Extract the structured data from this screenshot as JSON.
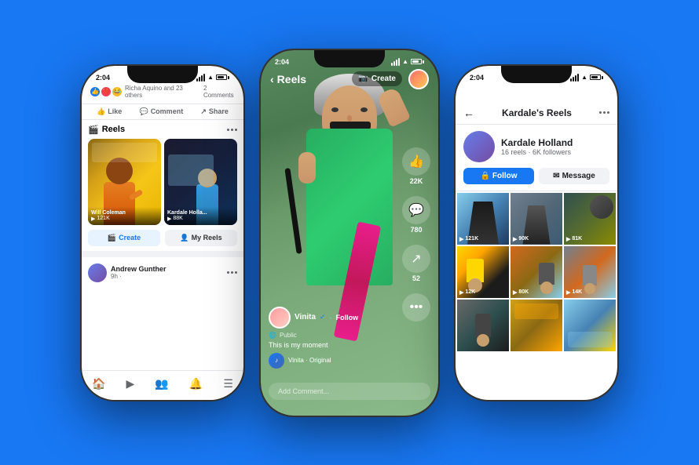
{
  "background_color": "#1877F2",
  "phones": {
    "left": {
      "status_time": "2:04",
      "reaction_text": "Richa Aquino and 23 others",
      "comments_count": "2 Comments",
      "actions": [
        "Like",
        "Comment",
        "Share"
      ],
      "reels_section_title": "Reels",
      "reels": [
        {
          "name": "Will Coleman",
          "views": "121K",
          "bg_class": "reel-bg-1"
        },
        {
          "name": "Kardale Holla...",
          "views": "88K",
          "bg_class": "reel-bg-2"
        }
      ],
      "btn_create": "Create",
      "btn_my_reels": "My Reels",
      "post_user": "Andrew Gunther",
      "post_time": "9h ·",
      "nav_items": [
        "home",
        "reels",
        "groups",
        "notifications",
        "menu"
      ]
    },
    "center": {
      "status_time": "2:04",
      "header_title": "Reels",
      "header_create": "Create",
      "username": "Vinita",
      "verified": true,
      "follow_text": "Follow",
      "privacy": "Public",
      "caption": "This is my moment",
      "music": "Vinita · Original",
      "likes_count": "22K",
      "comments_count": "780",
      "shares_count": "52",
      "comment_placeholder": "Add Comment..."
    },
    "right": {
      "status_time": "2:04",
      "page_title": "Kardale's Reels",
      "profile_name": "Kardale Holland",
      "profile_stats": "16 reels · 6K followers",
      "btn_follow": "Follow",
      "btn_message": "Message",
      "grid_items": [
        {
          "views": "121K",
          "bg": "gt1"
        },
        {
          "views": "90K",
          "bg": "gt2"
        },
        {
          "views": "81K",
          "bg": "gt3"
        },
        {
          "views": "12K",
          "bg": "gt4"
        },
        {
          "views": "80K",
          "bg": "gt5"
        },
        {
          "views": "14K",
          "bg": "gt6"
        },
        {
          "views": "",
          "bg": "gt7"
        },
        {
          "views": "",
          "bg": "gt8"
        },
        {
          "views": "",
          "bg": "gt9"
        }
      ]
    }
  }
}
